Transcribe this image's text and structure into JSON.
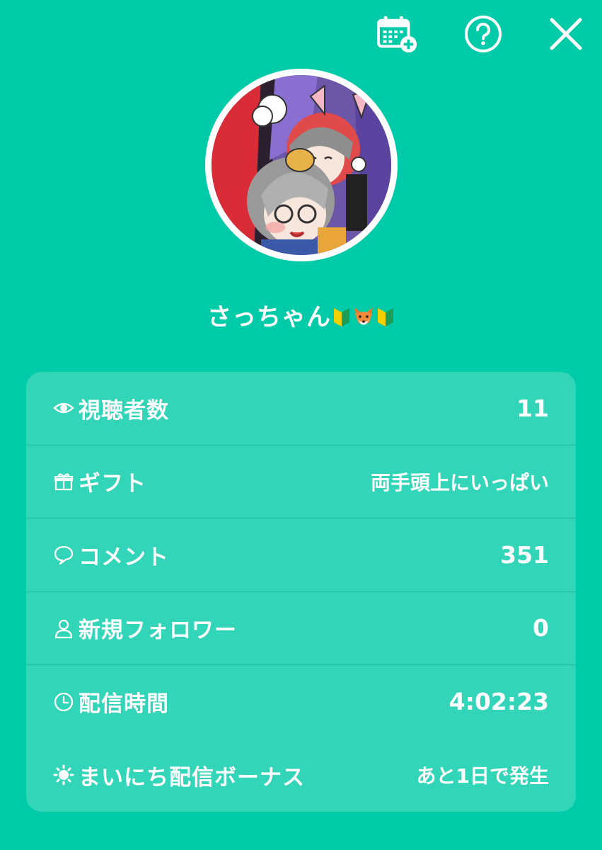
{
  "header": {
    "icons": [
      "calendar-add-icon",
      "help-icon",
      "close-icon"
    ]
  },
  "profile": {
    "username": "さっちゃん",
    "emojis": [
      "beginner-mark",
      "fox-face",
      "beginner-mark"
    ]
  },
  "stats": [
    {
      "icon": "eye-icon",
      "label": "視聴者数",
      "value": "11"
    },
    {
      "icon": "gift-icon",
      "label": "ギフト",
      "value": "両手頭上にいっぱい"
    },
    {
      "icon": "comment-icon",
      "label": "コメント",
      "value": "351"
    },
    {
      "icon": "person-icon",
      "label": "新規フォロワー",
      "value": "0"
    },
    {
      "icon": "clock-icon",
      "label": "配信時間",
      "value": "4:02:23"
    },
    {
      "icon": "sun-icon",
      "label": "まいにち配信ボーナス",
      "value": "あと1日で発生"
    }
  ],
  "colors": {
    "background": "#00cba8",
    "card": "#33d9bd",
    "text": "#ffffff"
  }
}
